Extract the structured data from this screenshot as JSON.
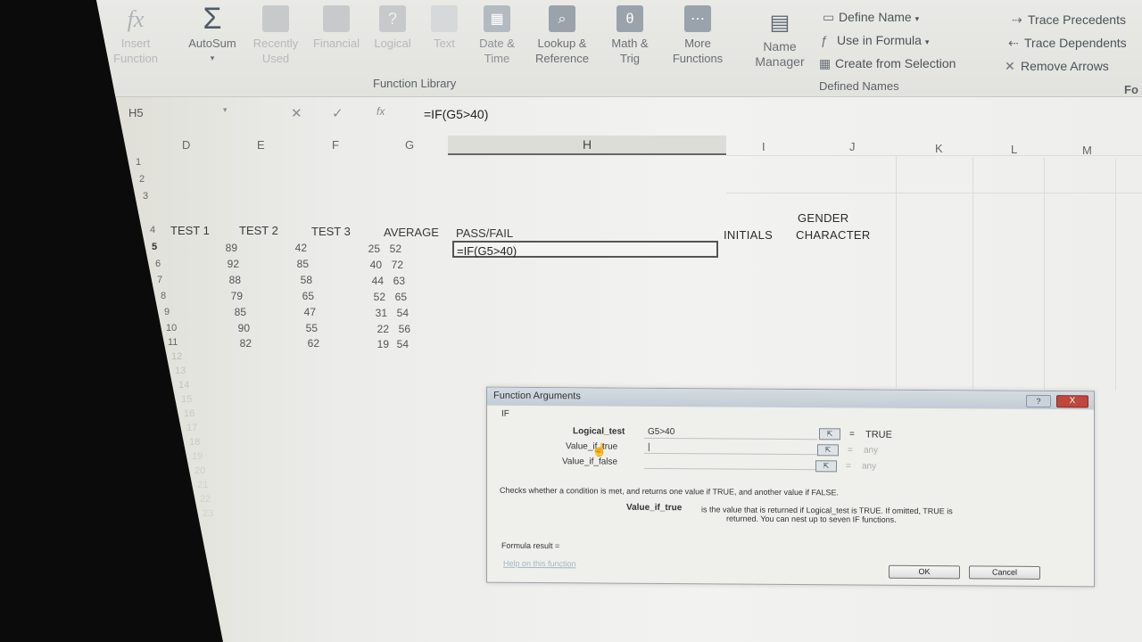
{
  "ribbon": {
    "buttons": [
      {
        "label": "Insert\nFunction",
        "icon": "fx-icon"
      },
      {
        "label": "AutoSum",
        "icon": "sigma-icon"
      },
      {
        "label": "Recently\nUsed",
        "icon": "star-icon"
      },
      {
        "label": "Financial",
        "icon": "book-icon"
      },
      {
        "label": "Logical",
        "icon": "question-icon"
      },
      {
        "label": "Text",
        "icon": "text-icon"
      },
      {
        "label": "Date &\nTime",
        "icon": "calendar-icon"
      },
      {
        "label": "Lookup &\nReference",
        "icon": "magnifier-icon"
      },
      {
        "label": "Math &\nTrig",
        "icon": "theta-icon"
      },
      {
        "label": "More\nFunctions",
        "icon": "more-icon"
      },
      {
        "label": "Name\nManager",
        "icon": "tag-icon"
      }
    ],
    "function_library_label": "Function Library",
    "defined_names_label": "Defined Names",
    "defined_names": [
      "Define Name",
      "Use in Formula",
      "Create from Selection"
    ],
    "auditing": [
      "Trace Precedents",
      "Trace Dependents",
      "Remove Arrows"
    ],
    "formula_auditing_label_partial": "Fo"
  },
  "formula_bar": {
    "name_box": "H5",
    "formula": "=IF(G5>40)"
  },
  "sheet": {
    "columns": [
      "D",
      "E",
      "F",
      "G",
      "H",
      "I",
      "J",
      "K",
      "L",
      "M"
    ],
    "rows": [
      "1",
      "2",
      "3",
      "4",
      "5",
      "6",
      "7",
      "8",
      "9",
      "10",
      "11",
      "12",
      "13",
      "14",
      "15",
      "16",
      "17",
      "18",
      "19",
      "20",
      "21",
      "22",
      "23"
    ],
    "headers": {
      "test1": "TEST 1",
      "test2": "TEST 2",
      "test3": "TEST 3",
      "average": "AVERAGE",
      "passfail": "PASS/FAIL",
      "initials": "INITIALS",
      "gender_line1": "GENDER",
      "gender_line2": "CHARACTER"
    },
    "data": [
      {
        "t1": "89",
        "t2": "42",
        "t3": "25",
        "avg": "52"
      },
      {
        "t1": "92",
        "t2": "85",
        "t3": "40",
        "avg": "72"
      },
      {
        "t1": "88",
        "t2": "58",
        "t3": "44",
        "avg": "63"
      },
      {
        "t1": "79",
        "t2": "65",
        "t3": "52",
        "avg": "65"
      },
      {
        "t1": "85",
        "t2": "47",
        "t3": "31",
        "avg": "54"
      },
      {
        "t1": "90",
        "t2": "55",
        "t3": "22",
        "avg": "56"
      },
      {
        "t1": "82",
        "t2": "62",
        "t3": "19",
        "avg": "54"
      }
    ],
    "active_cell_content": "=IF(G5>40)"
  },
  "dialog": {
    "title": "Function Arguments",
    "function_name": "IF",
    "args": [
      {
        "label": "Logical_test",
        "value": "G5>40",
        "result": "TRUE"
      },
      {
        "label": "Value_if_true",
        "value": "|",
        "result": "any"
      },
      {
        "label": "Value_if_false",
        "value": "",
        "result": "any"
      }
    ],
    "description": "Checks whether a condition is met, and returns one value if TRUE, and another value if FALSE.",
    "arg_help_label": "Value_if_true",
    "arg_help_text_1": "is the value that is returned if Logical_test is TRUE. If omitted, TRUE is",
    "arg_help_text_2": "returned. You can nest up to seven IF functions.",
    "formula_result_label": "Formula result =",
    "help_link": "Help on this function",
    "ok_label": "OK",
    "cancel_label": "Cancel",
    "help_btn": "?",
    "close_btn": "X",
    "equals": "="
  }
}
